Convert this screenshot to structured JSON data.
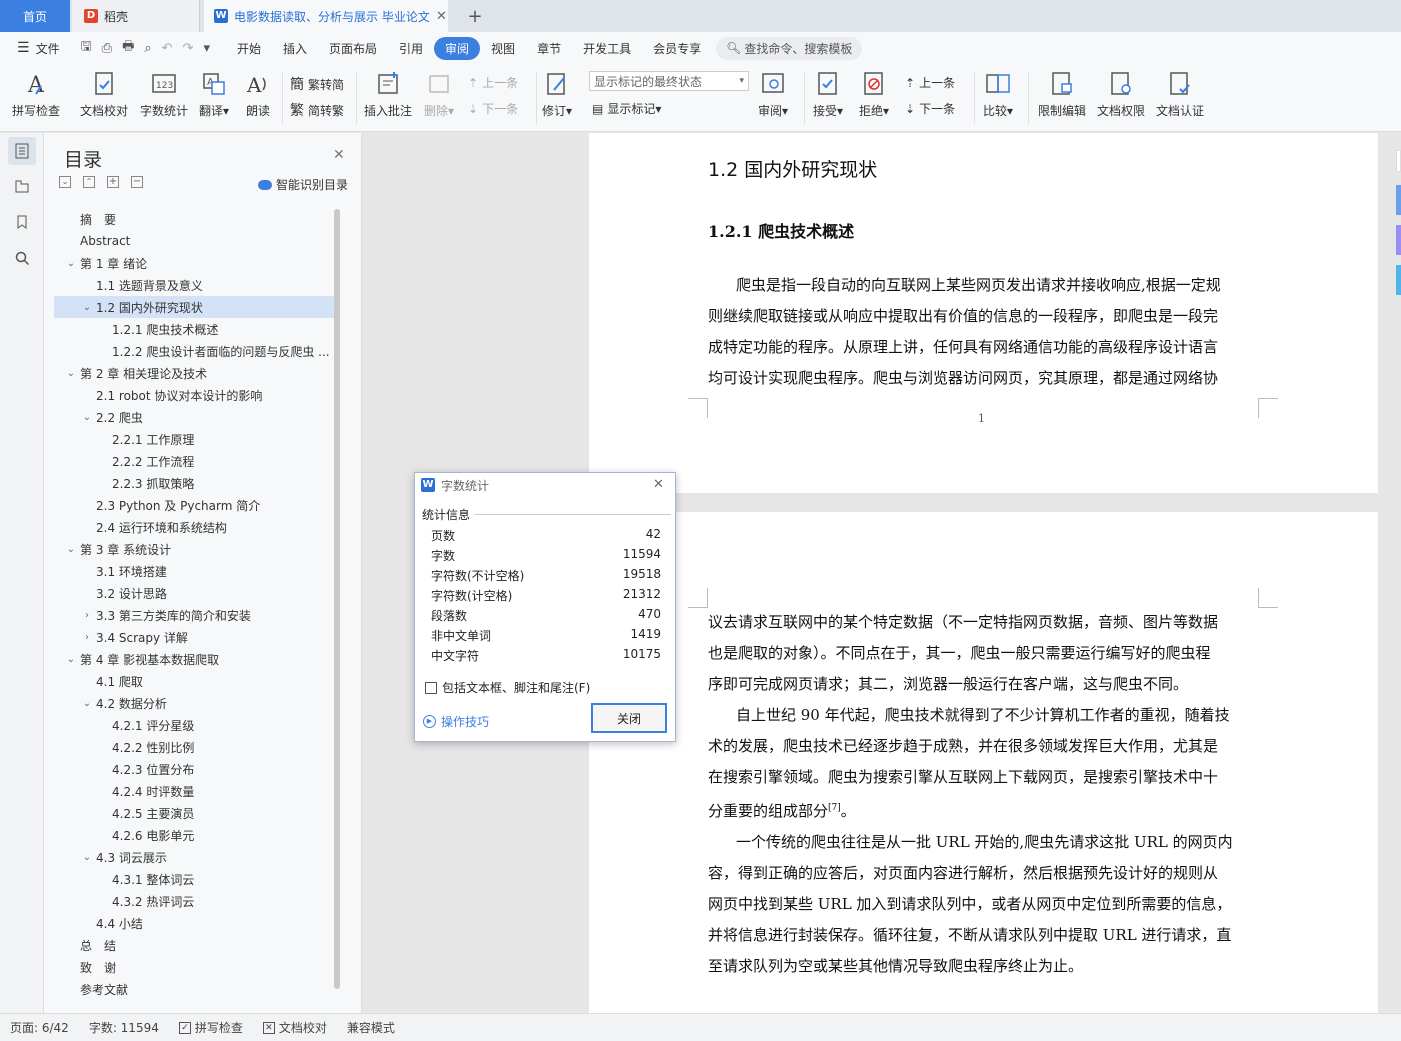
{
  "tabs": {
    "home": "首页",
    "daoke": "稻壳",
    "doc": "电影数据读取、分析与展示 毕业论文",
    "add": "+"
  },
  "menu": {
    "file": "文件",
    "items": [
      "开始",
      "插入",
      "页面布局",
      "引用",
      "审阅",
      "视图",
      "章节",
      "开发工具",
      "会员专享"
    ],
    "active": "审阅",
    "search_placeholder": "查找命令、搜索模板"
  },
  "ribbon": {
    "spell": "拼写检查",
    "proof": "文档校对",
    "wordcount": "字数统计",
    "translate": "翻译",
    "read": "朗读",
    "trad": "繁转简",
    "simp": "简转繁",
    "insert_comment": "插入批注",
    "delete": "删除",
    "prev1": "上一条",
    "next1": "下一条",
    "revise": "修订",
    "markup_state": "显示标记的最终状态",
    "show_markup": "显示标记",
    "review": "审阅",
    "accept": "接受",
    "reject": "拒绝",
    "prev2": "上一条",
    "next2": "下一条",
    "compare": "比较",
    "restrict": "限制编辑",
    "perm": "文档权限",
    "cert": "文档认证"
  },
  "toc": {
    "title": "目录",
    "smart": "智能识别目录",
    "items": [
      {
        "text": "摘　要",
        "level": 0,
        "caret": ""
      },
      {
        "text": "Abstract",
        "level": 0,
        "caret": ""
      },
      {
        "text": "第 1 章  绪论",
        "level": 0,
        "caret": "v"
      },
      {
        "text": "1.1  选题背景及意义",
        "level": 1,
        "caret": ""
      },
      {
        "text": "1.2  国内外研究现状",
        "level": 1,
        "caret": "v",
        "selected": true
      },
      {
        "text": "1.2.1  爬虫技术概述",
        "level": 2,
        "caret": ""
      },
      {
        "text": "1.2.2  爬虫设计者面临的问题与反爬虫 ...",
        "level": 2,
        "caret": ""
      },
      {
        "text": "第 2 章  相关理论及技术",
        "level": 0,
        "caret": "v"
      },
      {
        "text": "2.1 robot 协议对本设计的影响",
        "level": 1,
        "caret": ""
      },
      {
        "text": "2.2  爬虫",
        "level": 1,
        "caret": "v"
      },
      {
        "text": "2.2.1  工作原理",
        "level": 2,
        "caret": ""
      },
      {
        "text": "2.2.2  工作流程",
        "level": 2,
        "caret": ""
      },
      {
        "text": "2.2.3  抓取策略",
        "level": 2,
        "caret": ""
      },
      {
        "text": "2.3 Python 及 Pycharm 简介",
        "level": 1,
        "caret": ""
      },
      {
        "text": "2.4 运行环境和系统结构",
        "level": 1,
        "caret": ""
      },
      {
        "text": "第 3 章  系统设计",
        "level": 0,
        "caret": "v"
      },
      {
        "text": "3.1 环境搭建",
        "level": 1,
        "caret": ""
      },
      {
        "text": "3.2 设计思路",
        "level": 1,
        "caret": ""
      },
      {
        "text": "3.3  第三方类库的简介和安装",
        "level": 1,
        "caret": ">"
      },
      {
        "text": "3.4 Scrapy 详解",
        "level": 1,
        "caret": ">"
      },
      {
        "text": "第 4 章  影视基本数据爬取",
        "level": 0,
        "caret": "v"
      },
      {
        "text": "4.1 爬取",
        "level": 1,
        "caret": ""
      },
      {
        "text": "4.2 数据分析",
        "level": 1,
        "caret": "v"
      },
      {
        "text": "4.2.1 评分星级",
        "level": 2,
        "caret": ""
      },
      {
        "text": "4.2.2 性别比例",
        "level": 2,
        "caret": ""
      },
      {
        "text": "4.2.3 位置分布",
        "level": 2,
        "caret": ""
      },
      {
        "text": "4.2.4 时评数量",
        "level": 2,
        "caret": ""
      },
      {
        "text": "4.2.5 主要演员",
        "level": 2,
        "caret": ""
      },
      {
        "text": "4.2.6 电影单元",
        "level": 2,
        "caret": ""
      },
      {
        "text": "4.3 词云展示",
        "level": 1,
        "caret": "v"
      },
      {
        "text": "4.3.1 整体词云",
        "level": 2,
        "caret": ""
      },
      {
        "text": "4.3.2 热评词云",
        "level": 2,
        "caret": ""
      },
      {
        "text": "4.4 小结",
        "level": 1,
        "caret": ""
      },
      {
        "text": "总　结",
        "level": 0,
        "caret": ""
      },
      {
        "text": "致　谢",
        "level": 0,
        "caret": ""
      },
      {
        "text": "参考文献",
        "level": 0,
        "caret": ""
      }
    ]
  },
  "doc": {
    "h2": "1.2  国内外研究现状",
    "h3": "1.2.1   爬虫技术概述",
    "page1_lines": [
      "爬虫是指一段自动的向互联网上某些网页发出请求并接收响应,根据一定规",
      "则继续爬取链接或从响应中提取出有价值的信息的一段程序，即爬虫是一段完",
      "成特定功能的程序。从原理上讲，任何具有网络通信功能的高级程序设计语言",
      "均可设计实现爬虫程序。爬虫与浏览器访问网页，究其原理，都是通过网络协"
    ],
    "page_number": "1",
    "page2_lines": [
      "议去请求互联网中的某个特定数据（不一定特指网页数据，音频、图片等数据",
      "也是爬取的对象）。不同点在于，其一，爬虫一般只需要运行编写好的爬虫程",
      "序即可完成网页请求；其二，浏览器一般运行在客户端，这与爬虫不同。",
      "自上世纪 90 年代起，爬虫技术就得到了不少计算机工作者的重视，随着技",
      "术的发展，爬虫技术已经逐步趋于成熟，并在很多领域发挥巨大作用，尤其是",
      "在搜索引擎领域。爬虫为搜索引擎从互联网上下载网页，是搜索引擎技术中十",
      "分重要的组成部分",
      "一个传统的爬虫往往是从一批 URL 开始的,爬虫先请求这批 URL 的网页内",
      "容，得到正确的应答后，对页面内容进行解析，然后根据预先设计好的规则从",
      "网页中找到某些 URL 加入到请求队列中，或者从网页中定位到所需要的信息，",
      "并将信息进行封装保存。循环往复，不断从请求队列中提取 URL 进行请求，直",
      "至请求队列为空或某些其他情况导致爬虫程序终止为止。"
    ],
    "ref": "[7]",
    "period": "。"
  },
  "dialog": {
    "title": "字数统计",
    "section": "统计信息",
    "rows": [
      {
        "label": "页数",
        "value": "42"
      },
      {
        "label": "字数",
        "value": "11594"
      },
      {
        "label": "字符数(不计空格)",
        "value": "19518"
      },
      {
        "label": "字符数(计空格)",
        "value": "21312"
      },
      {
        "label": "段落数",
        "value": "470"
      },
      {
        "label": "非中文单词",
        "value": "1419"
      },
      {
        "label": "中文字符",
        "value": "10175"
      }
    ],
    "checkbox": "包括文本框、脚注和尾注(F)",
    "tips": "操作技巧",
    "close": "关闭"
  },
  "status": {
    "page": "页面: 6/42",
    "words": "字数: 11594",
    "spell": "拼写检查",
    "proof": "文档校对",
    "compat": "兼容模式"
  },
  "colors": {
    "accent": "#3b7fe0",
    "selected": "#d4e2f7"
  }
}
